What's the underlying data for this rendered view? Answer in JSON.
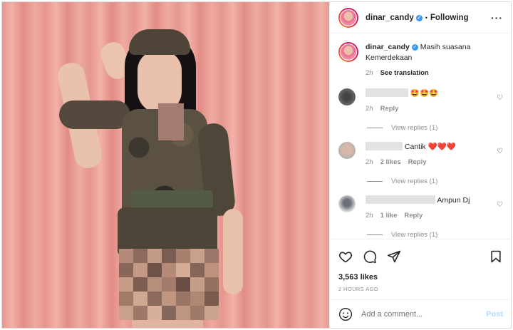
{
  "post": {
    "username": "dinar_candy",
    "follow_status": "Following",
    "caption": "Masih suasana Kemerdekaan",
    "caption_time": "2h",
    "see_translation": "See translation"
  },
  "comments": [
    {
      "text": "🤩🤩🤩",
      "time": "2h",
      "likes": "",
      "reply": "Reply",
      "view_replies": "View replies (1)"
    },
    {
      "text": "Cantik ❤️❤️❤️",
      "time": "2h",
      "likes": "2 likes",
      "reply": "Reply",
      "view_replies": "View replies (1)"
    },
    {
      "text": "Ampun Dj",
      "time": "2h",
      "likes": "1 like",
      "reply": "Reply",
      "view_replies": "View replies (1)"
    }
  ],
  "stats": {
    "likes": "3,563 likes",
    "age": "2 HOURS AGO"
  },
  "composer": {
    "placeholder": "Add a comment...",
    "post_label": "Post"
  },
  "icons": {
    "like": "heart-icon",
    "comment": "comment-bubble-icon",
    "share": "paper-plane-icon",
    "save": "bookmark-icon",
    "emoji": "smiley-icon",
    "more": "ellipsis-icon"
  },
  "colors": {
    "accent": "#3897f0",
    "post_button": "#b3dbff",
    "muted": "#8e8e8e"
  }
}
